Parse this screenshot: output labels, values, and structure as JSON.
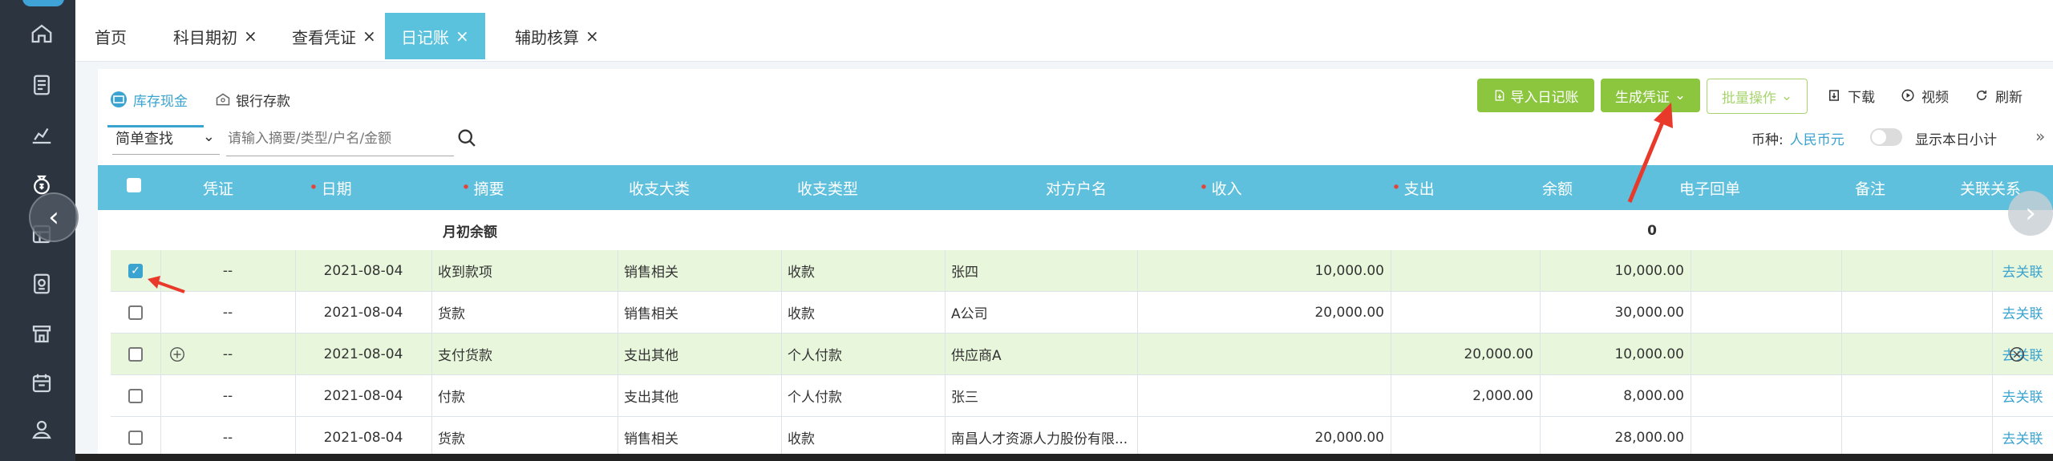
{
  "tabs": [
    {
      "label": "首页",
      "closable": false,
      "active": false
    },
    {
      "label": "科目期初",
      "closable": true,
      "active": false
    },
    {
      "label": "查看凭证",
      "closable": true,
      "active": false
    },
    {
      "label": "日记账",
      "closable": true,
      "active": true
    },
    {
      "label": "辅助核算",
      "closable": true,
      "active": false
    }
  ],
  "close_glyph": "×",
  "subtabs": {
    "cash": "库存现金",
    "bank": "银行存款"
  },
  "toolbar": {
    "import": "导入日记账",
    "generate": "生成凭证",
    "batch": "批量操作",
    "download": "下载",
    "video": "视频",
    "refresh": "刷新"
  },
  "search": {
    "mode": "简单查找",
    "placeholder": "请输入摘要/类型/户名/金额"
  },
  "currency": {
    "label": "币种:",
    "value": "人民币元"
  },
  "toggle_label": "显示本日小计",
  "columns": [
    "凭证",
    "日期",
    "摘要",
    "收支大类",
    "收支类型",
    "对方户名",
    "收入",
    "支出",
    "余额",
    "电子回单",
    "备注",
    "关联关系"
  ],
  "opening_row": {
    "label": "月初余额",
    "balance": "0"
  },
  "rows": [
    {
      "checked": true,
      "voucher": "--",
      "date": "2021-08-04",
      "summary": "收到款项",
      "category": "销售相关",
      "type": "收款",
      "counterparty": "张四",
      "income": "10,000.00",
      "expense": "",
      "balance": "10,000.00",
      "action": "去关联"
    },
    {
      "checked": false,
      "voucher": "--",
      "date": "2021-08-04",
      "summary": "货款",
      "category": "销售相关",
      "type": "收款",
      "counterparty": "A公司",
      "income": "20,000.00",
      "expense": "",
      "balance": "30,000.00",
      "action": "去关联"
    },
    {
      "checked": false,
      "voucher": "--",
      "date": "2021-08-04",
      "summary": "支付货款",
      "category": "支出其他",
      "type": "个人付款",
      "counterparty": "供应商A",
      "income": "",
      "expense": "20,000.00",
      "balance": "10,000.00",
      "action": "去关联"
    },
    {
      "checked": false,
      "voucher": "--",
      "date": "2021-08-04",
      "summary": "付款",
      "category": "支出其他",
      "type": "个人付款",
      "counterparty": "张三",
      "income": "",
      "expense": "2,000.00",
      "balance": "8,000.00",
      "action": "去关联"
    },
    {
      "checked": false,
      "voucher": "--",
      "date": "2021-08-04",
      "summary": "货款",
      "category": "销售相关",
      "type": "收款",
      "counterparty": "南昌人才资源人力股份有限...",
      "income": "20,000.00",
      "expense": "",
      "balance": "28,000.00",
      "action": "去关联"
    }
  ],
  "colors": {
    "sidebar": "#2c3440",
    "accent": "#5ac2dc",
    "green": "#8cc63f",
    "row_highlight": "#e8f6dc"
  },
  "sidebar_icons": [
    "home-icon",
    "report-icon",
    "chart-icon",
    "money-bag-icon",
    "ledger-icon",
    "stamp-icon",
    "store-icon",
    "calendar-icon",
    "hand-coin-icon"
  ]
}
